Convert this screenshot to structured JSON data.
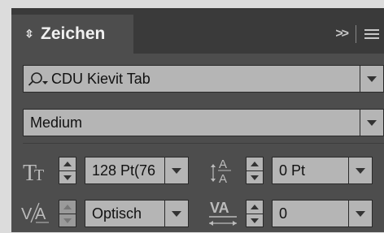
{
  "panel": {
    "title": "Zeichen",
    "tab_more": ">>"
  },
  "font_family": {
    "value": "CDU Kievit Tab"
  },
  "font_style": {
    "value": "Medium"
  },
  "font_size": {
    "value": "128 Pt(76"
  },
  "leading": {
    "value": "0 Pt"
  },
  "kerning": {
    "value": "Optisch"
  },
  "tracking": {
    "value": "0"
  },
  "icons": {
    "font_size": "TT",
    "leading_top": "A",
    "leading_bottom": "A",
    "kerning": "V/A",
    "tracking": "VA"
  },
  "colors": {
    "panel_bg": "#4d4d4d",
    "field_bg": "#b5b5b5",
    "outer_bg": "#dcdcdc"
  }
}
